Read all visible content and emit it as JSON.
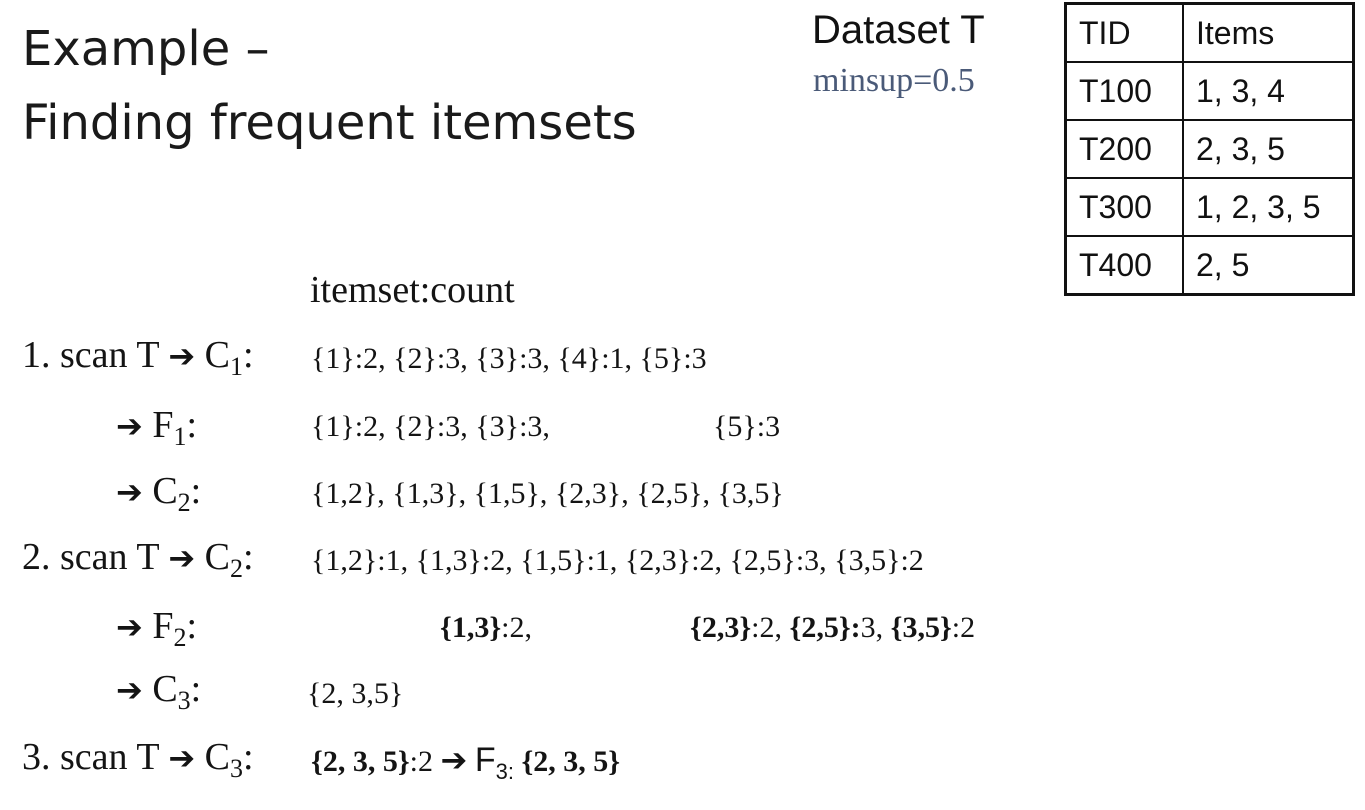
{
  "title": {
    "line1": "Example –",
    "line2": "Finding frequent itemsets"
  },
  "dataset": {
    "title": "Dataset T",
    "minsup": "minsup=0.5",
    "minsup_color": "#4a5a78",
    "columns": [
      "TID",
      "Items"
    ],
    "rows": [
      {
        "tid": "T100",
        "items": "1, 3, 4"
      },
      {
        "tid": "T200",
        "items": "2, 3, 5"
      },
      {
        "tid": "T300",
        "items": "1, 2, 3, 5"
      },
      {
        "tid": "T400",
        "items": "2, 5"
      }
    ]
  },
  "header": "itemset:count",
  "steps": {
    "s1": {
      "prefix": "1. scan T",
      "label": "C",
      "sub": "1",
      "colon": ":",
      "values": "{1}:2, {2}:3, {3}:3, {4}:1, {5}:3"
    },
    "f1": {
      "label": "F",
      "sub": "1",
      "colon": ":",
      "values_a": "{1}:2, {2}:3, {3}:3,",
      "values_b": "{5}:3"
    },
    "c2": {
      "label": "C",
      "sub": "2",
      "colon": ":",
      "values": "{1,2}, {1,3}, {1,5}, {2,3}, {2,5}, {3,5}"
    },
    "s2": {
      "prefix": "2. scan T",
      "label": "C",
      "sub": "2",
      "colon": ":",
      "values": "{1,2}:1, {1,3}:2, {1,5}:1, {2,3}:2, {2,5}:3, {3,5}:2"
    },
    "f2": {
      "label": "F",
      "sub": "2",
      "colon": ":",
      "a": {
        "open": "{",
        "set": "1,3",
        "close": "}",
        "count": ":2,"
      },
      "b": {
        "open": "{",
        "set": "2,3",
        "close": "}",
        "count": ":2,"
      },
      "c": {
        "open": "{",
        "set": "2,5",
        "close": "}:",
        "count": "3,"
      },
      "d": {
        "open": "{",
        "set": "3,5",
        "close": "}",
        "count": ":2"
      }
    },
    "c3": {
      "label": "C",
      "sub": "3",
      "colon": ":",
      "values": "{2, 3,5}"
    },
    "s3": {
      "prefix": "3. scan T",
      "label": "C",
      "sub": "3",
      "colon": ":",
      "values_open": "{",
      "values_set": "2, 3, 5",
      "values_close": "}",
      "values_count": ":2",
      "result_label": "F",
      "result_sub": "3:",
      "result_open": "{",
      "result_set": "2, 3, 5",
      "result_close": "}"
    }
  }
}
